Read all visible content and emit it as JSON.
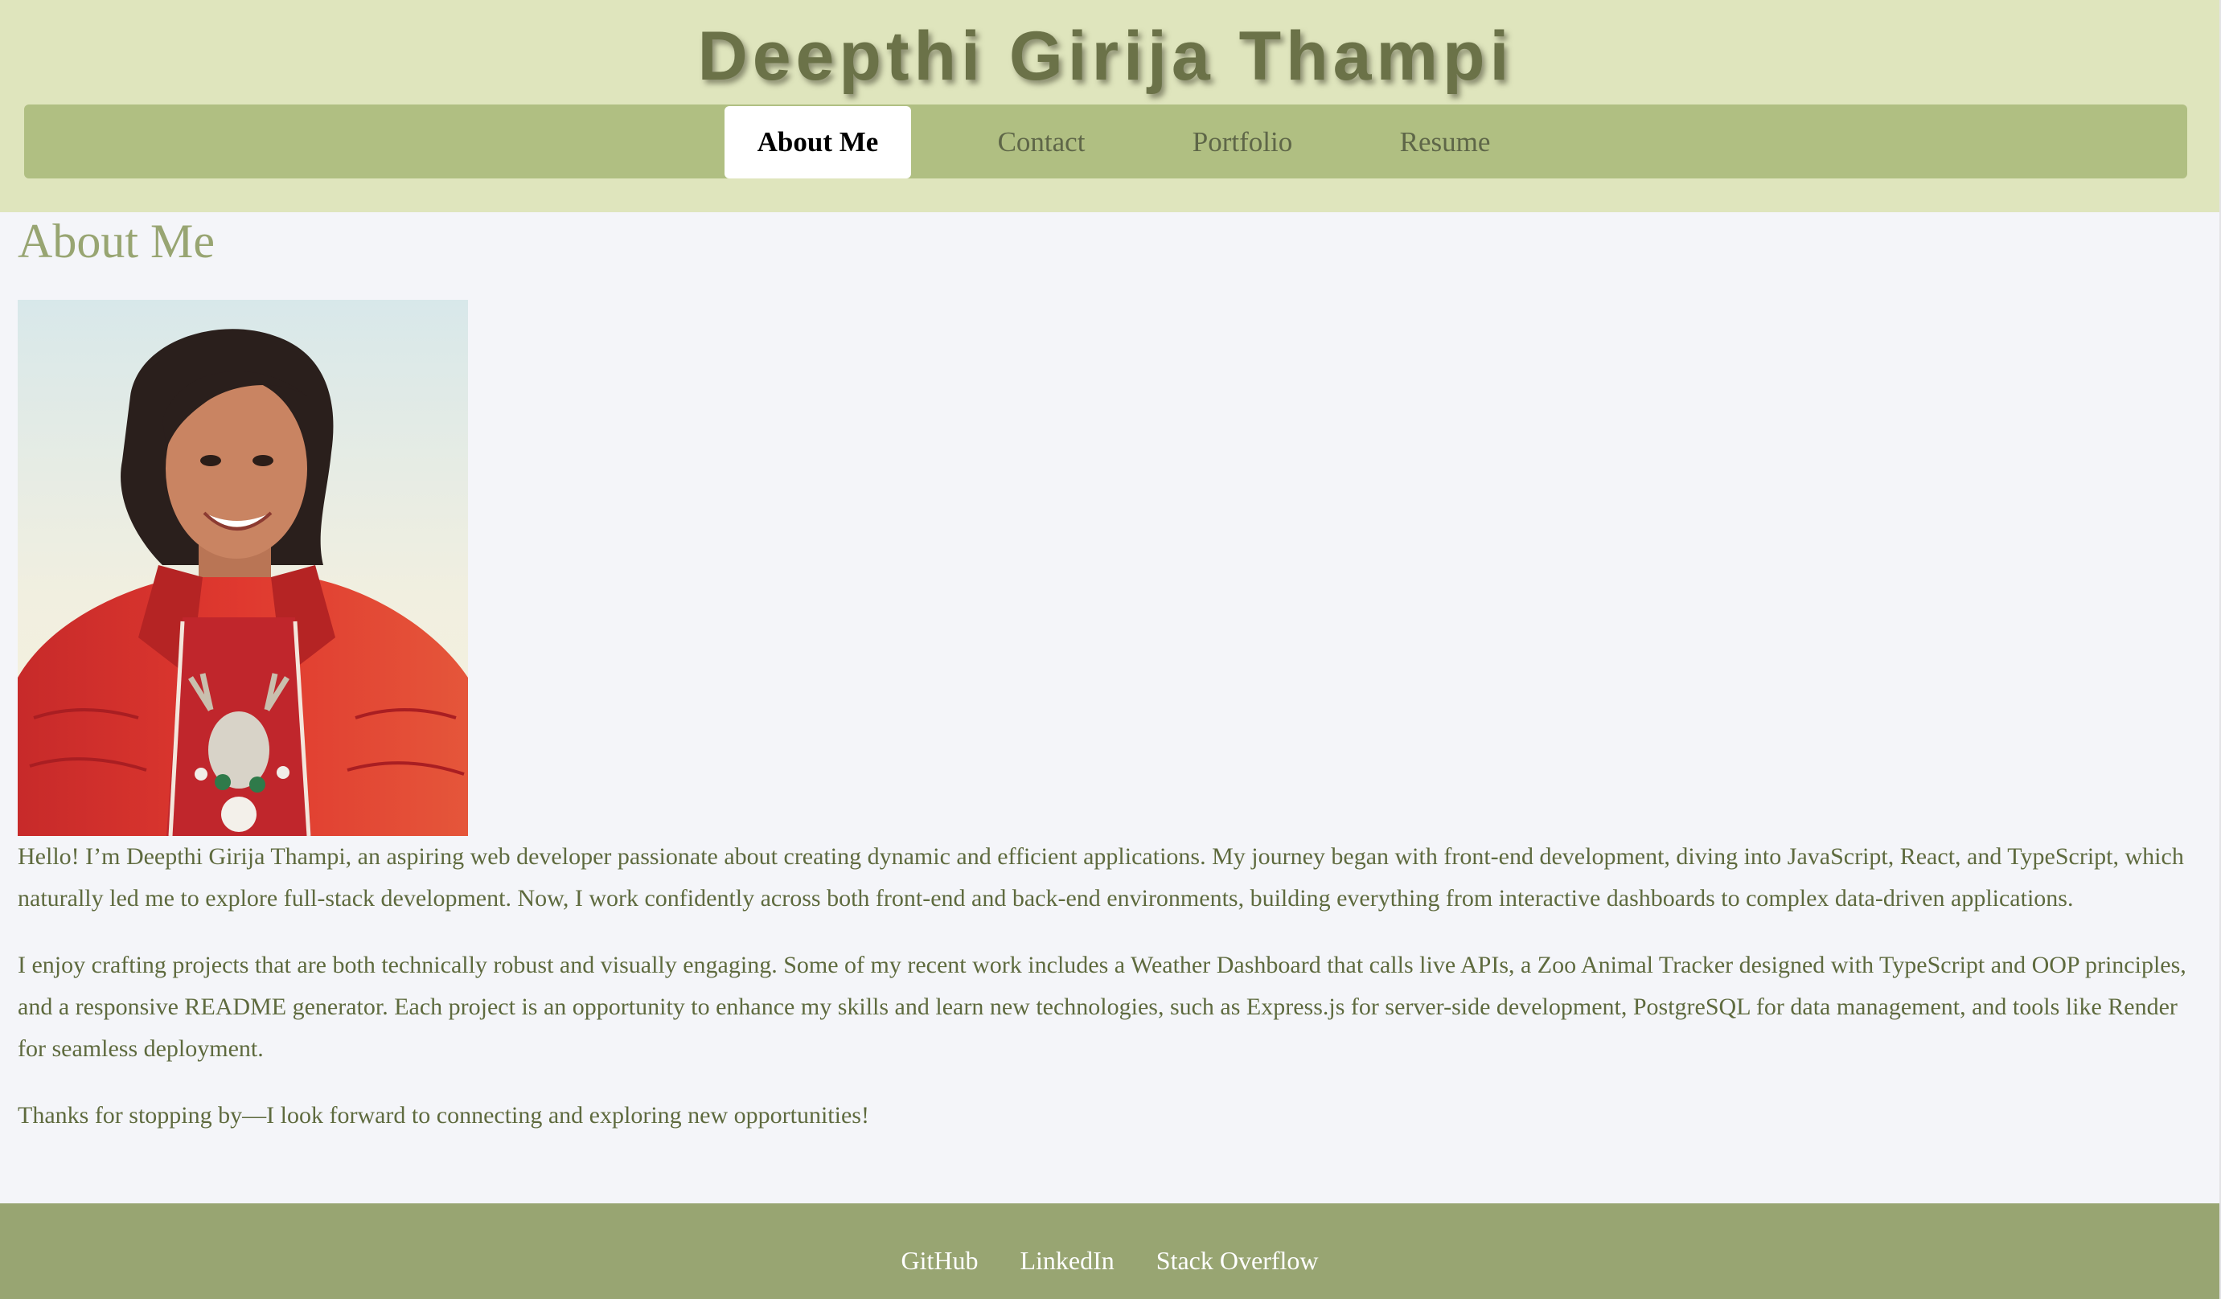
{
  "header": {
    "title": "Deepthi Girija Thampi"
  },
  "nav": {
    "items": [
      {
        "label": "About Me",
        "active": true
      },
      {
        "label": "Contact",
        "active": false
      },
      {
        "label": "Portfolio",
        "active": false
      },
      {
        "label": "Resume",
        "active": false
      }
    ]
  },
  "main": {
    "heading": "About Me",
    "photo_alt": "Photo of Deepthi Girija Thampi",
    "paragraphs": [
      "Hello! I’m Deepthi Girija Thampi, an aspiring web developer passionate about creating dynamic and efficient applications. My journey began with front-end development, diving into JavaScript, React, and TypeScript, which naturally led me to explore full-stack development. Now, I work confidently across both front-end and back-end environments, building everything from interactive dashboards to complex data-driven applications.",
      "I enjoy crafting projects that are both technically robust and visually engaging. Some of my recent work includes a Weather Dashboard that calls live APIs, a Zoo Animal Tracker designed with TypeScript and OOP principles, and a responsive README generator. Each project is an opportunity to enhance my skills and learn new technologies, such as Express.js for server-side development, PostgreSQL for data management, and tools like Render for seamless deployment.",
      "Thanks for stopping by—I look forward to connecting and exploring new opportunities!"
    ]
  },
  "footer": {
    "links": [
      "GitHub",
      "LinkedIn",
      "Stack Overflow"
    ]
  },
  "colors": {
    "header_bg": "#dfe5bd",
    "nav_bg": "#b0bf82",
    "title_text": "#6b7248",
    "heading_text": "#98a572",
    "body_text": "#5e6a3e",
    "footer_bg": "#98a572",
    "page_bg": "#f4f5f9"
  }
}
